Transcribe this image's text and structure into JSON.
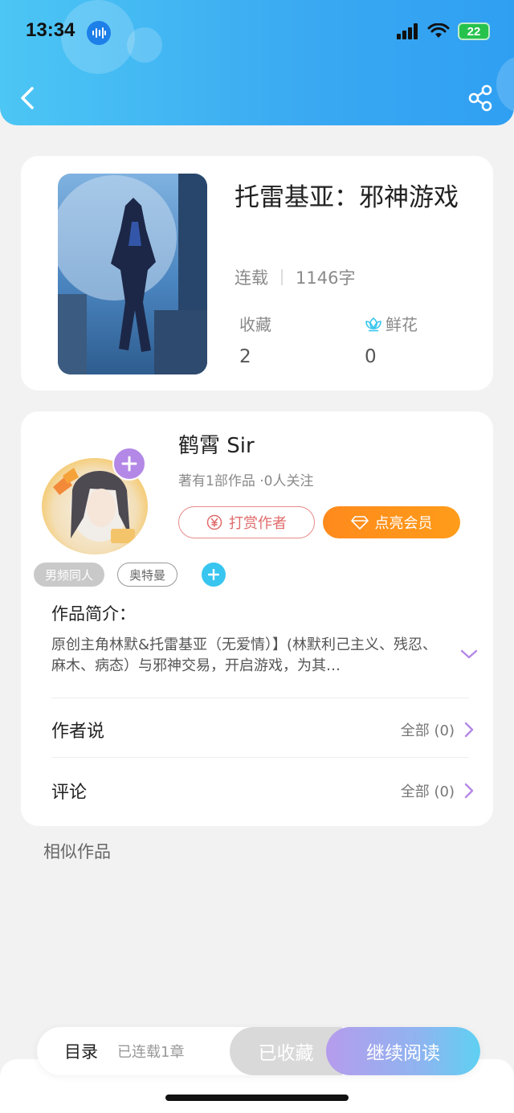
{
  "status_bar": {
    "time": "13:34",
    "battery": "22"
  },
  "book": {
    "title": "托雷基亚：邪神游戏",
    "status": "连载",
    "word_count": "1146字",
    "stats": [
      {
        "label": "收藏",
        "value": "2"
      },
      {
        "label": "鲜花",
        "value": "0"
      }
    ]
  },
  "author": {
    "name": "鹤霄 Sir",
    "summary": "著有1部作品 ·0人关注",
    "reward_label": "打赏作者",
    "vip_label": "点亮会员",
    "tags": [
      "男频同人",
      "奥特曼"
    ]
  },
  "intro": {
    "title": "作品简介：",
    "text": "原创主角林默&托雷基亚（无爱情）】(林默利己主义、残忍、麻木、病态）与邪神交易，开启游戏，为其…"
  },
  "rows": [
    {
      "label": "作者说",
      "right": "全部 (0)"
    },
    {
      "label": "评论",
      "right": "全部 (0)"
    }
  ],
  "similar_title": "相似作品",
  "bottom": {
    "toc_label": "目录",
    "toc_status": "已连载1章",
    "collected_label": "已收藏",
    "read_label": "继续阅读"
  },
  "colors": {
    "header_gradient_start": "#4cc6f4",
    "header_gradient_end": "#2f9ff2",
    "vip_orange": "#ff8a1c",
    "reward_red": "#e06b6b",
    "accent_purple": "#b488e6",
    "accent_cyan": "#38c5ef"
  }
}
